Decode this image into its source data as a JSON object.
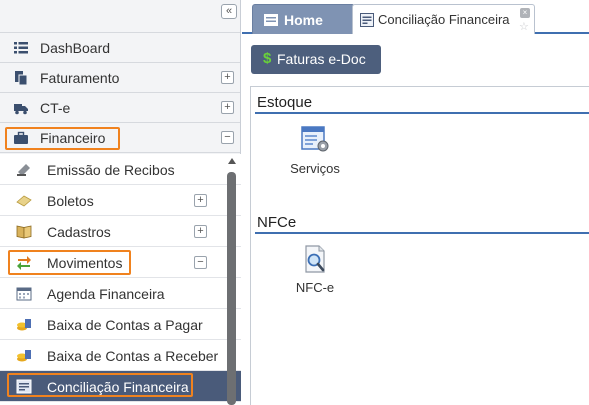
{
  "sidebar": {
    "collapse_symbol": "«",
    "items": [
      {
        "label": "DashBoard",
        "icon": "list-icon",
        "toggle": ""
      },
      {
        "label": "Faturamento",
        "icon": "documents-icon",
        "toggle": "+"
      },
      {
        "label": "CT-e",
        "icon": "truck-icon",
        "toggle": "+"
      },
      {
        "label": "Financeiro",
        "icon": "briefcase-icon",
        "toggle": "−"
      }
    ],
    "submenu": [
      {
        "label": "Emissão de Recibos",
        "icon": "stamp-icon",
        "toggle": ""
      },
      {
        "label": "Boletos",
        "icon": "eraser-icon",
        "toggle": "+"
      },
      {
        "label": "Cadastros",
        "icon": "book-icon",
        "toggle": "+"
      },
      {
        "label": "Movimentos",
        "icon": "arrows-icon",
        "toggle": "−"
      },
      {
        "label": "Agenda Financeira",
        "icon": "calendar-icon",
        "toggle": ""
      },
      {
        "label": "Baixa de Contas a Pagar",
        "icon": "coins-icon",
        "toggle": ""
      },
      {
        "label": "Baixa de Contas a Receber",
        "icon": "coins-icon",
        "toggle": ""
      },
      {
        "label": "Conciliação Financeira",
        "icon": "reconcile-icon",
        "toggle": "",
        "active": true
      }
    ]
  },
  "tabs": {
    "home_label": "Home",
    "conciliacao_label": "Conciliação Financeira",
    "close_symbol": "×",
    "star_symbol": "☆"
  },
  "toolbar": {
    "faturas_symbol": "$",
    "faturas_label": "Faturas e-Doc"
  },
  "sections": [
    {
      "title": "Estoque",
      "tiles": [
        {
          "label": "Serviços",
          "icon": "services-icon"
        }
      ]
    },
    {
      "title": "NFCe",
      "tiles": [
        {
          "label": "NFC-e",
          "icon": "search-document-icon"
        }
      ]
    }
  ],
  "colors": {
    "highlight": "#f0821e",
    "active_bg": "#4a5b7a",
    "accent_line": "#3f6fb0",
    "button_bg": "#4d5f7d",
    "dollar": "#69d13a"
  }
}
